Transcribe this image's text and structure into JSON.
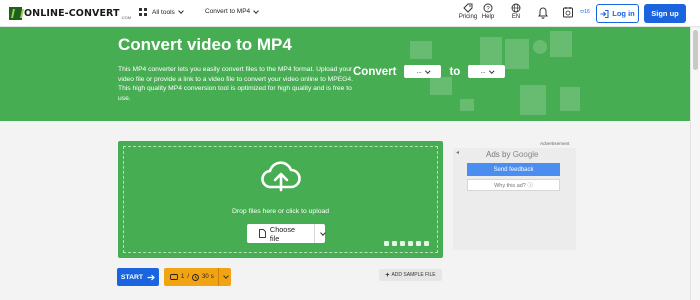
{
  "header": {
    "logo_text": "ONLINE-CONVERT",
    "logo_suffix": ".COM",
    "all_tools_label": "All tools",
    "converter_label": "Convert to MP4",
    "pricing_label": "Pricing",
    "help_label": "Help",
    "language_label": "EN",
    "credits_count": "16",
    "login_label": "Log in",
    "signup_label": "Sign up",
    "accent_color": "#1a64e0"
  },
  "hero": {
    "title": "Convert video to MP4",
    "description": "This MP4 converter lets you easily convert files to the MP4 format. Upload your video file or provide a link to a video file to convert your video online to MPEG4. This high quality MP4 conversion tool is optimized for high quality and is free to use.",
    "convert_label": "Convert",
    "from_value": "...",
    "to_label": "to",
    "to_value": "...",
    "background_color": "#47ad52"
  },
  "upload": {
    "drop_text": "Drop files here or click to upload",
    "choose_label": "Choose file"
  },
  "actions": {
    "start_label": "START",
    "files_count": "1",
    "separator": "/",
    "duration": "30",
    "duration_unit": "s",
    "add_sample_label": "ADD SAMPLE FILE"
  },
  "ad": {
    "label": "Advertisement",
    "back": "◂",
    "ads_by": "Ads by",
    "google": "Google",
    "feedback_label": "Send feedback",
    "why_label": "Why this ad? ⓘ"
  },
  "icons": {
    "grid": "grid-icon",
    "pricing": "pricing-tag-icon",
    "help": "help-circle-icon",
    "globe": "globe-icon",
    "bell": "bell-icon",
    "history": "history-icon",
    "cloud_upload": "cloud-upload-icon"
  }
}
